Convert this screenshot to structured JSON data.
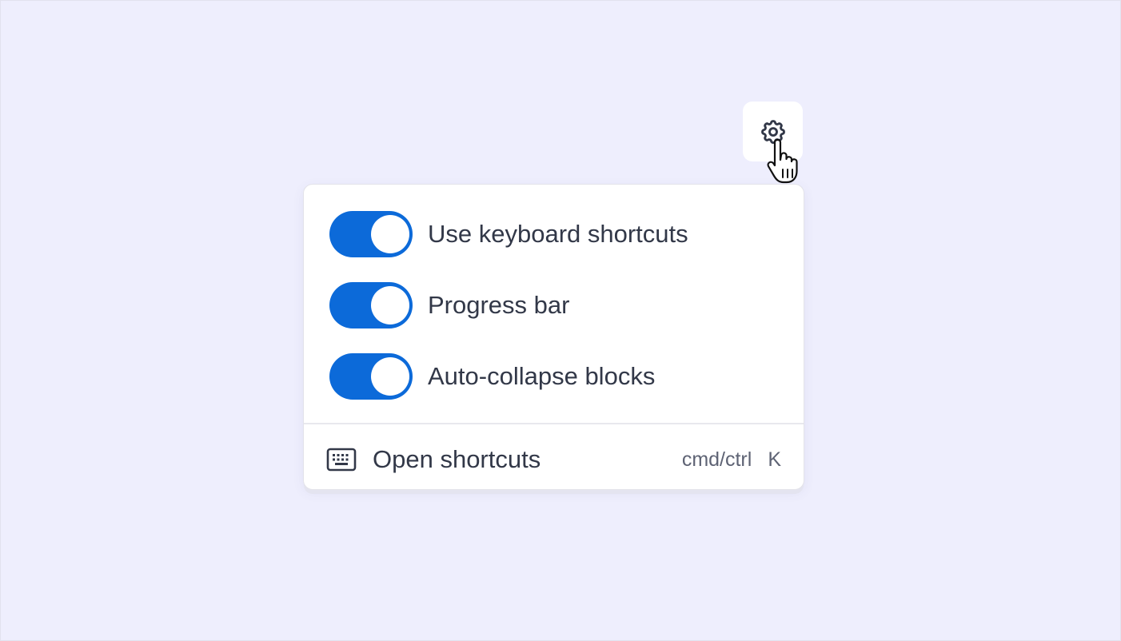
{
  "settings_button": {
    "icon": "gear-icon"
  },
  "cursor": {
    "icon": "hand-pointer-icon"
  },
  "menu": {
    "toggles": [
      {
        "label": "Use keyboard shortcuts",
        "on": true
      },
      {
        "label": "Progress bar",
        "on": true
      },
      {
        "label": "Auto-collapse blocks",
        "on": true
      }
    ],
    "footer": {
      "icon": "keyboard-icon",
      "label": "Open shortcuts",
      "shortcut_modifier": "cmd/ctrl",
      "shortcut_key": "K"
    }
  },
  "colors": {
    "background": "#eeeefd",
    "toggle_on": "#0c6ad9",
    "text": "#323848",
    "muted_text": "#5e6374"
  }
}
